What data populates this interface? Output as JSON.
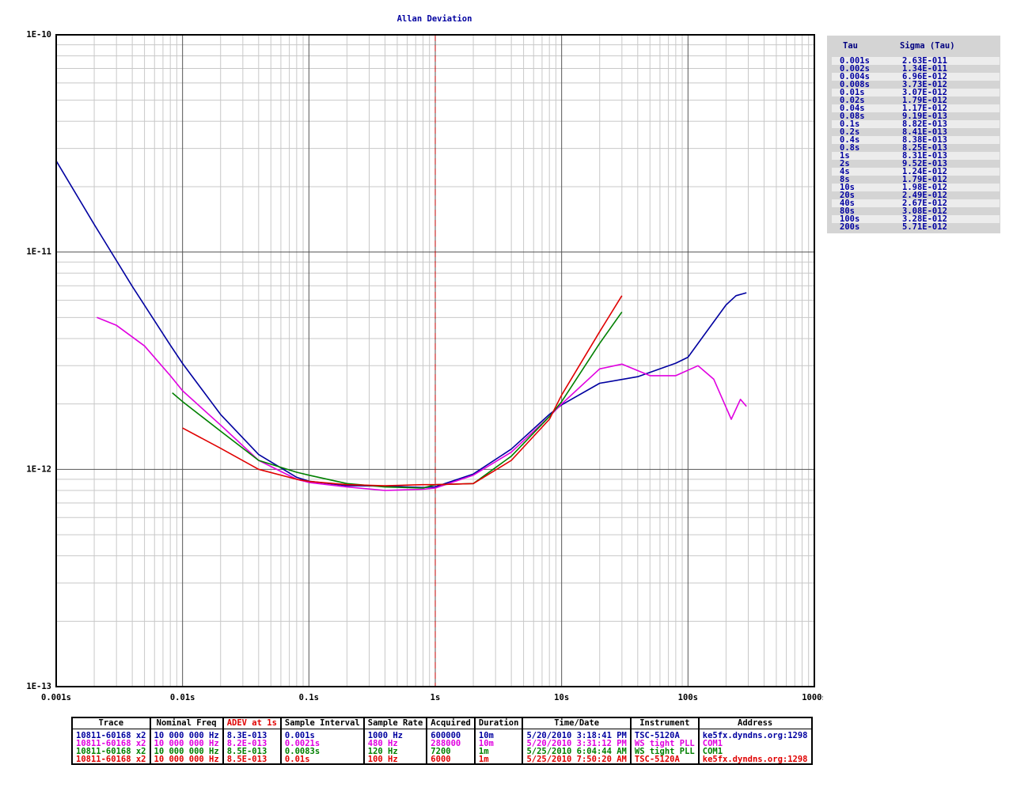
{
  "chart_data": {
    "type": "line",
    "title": "Allan Deviation",
    "x_scale": "log",
    "y_scale": "log",
    "xlim": [
      0.001,
      1000
    ],
    "ylim": [
      1e-13,
      1e-10
    ],
    "x_ticks": [
      {
        "v": 0.001,
        "label": "0.001s"
      },
      {
        "v": 0.01,
        "label": "0.01s"
      },
      {
        "v": 0.1,
        "label": "0.1s"
      },
      {
        "v": 1,
        "label": "1s"
      },
      {
        "v": 10,
        "label": "10s"
      },
      {
        "v": 100,
        "label": "100s"
      },
      {
        "v": 1000,
        "label": "1000s"
      }
    ],
    "y_ticks": [
      {
        "v": 1e-10,
        "label": "1E-10"
      },
      {
        "v": 1e-11,
        "label": "1E-11"
      },
      {
        "v": 1e-12,
        "label": "1E-12"
      },
      {
        "v": 1e-13,
        "label": "1E-13"
      }
    ],
    "grid": true,
    "marker_tau": 1,
    "series": [
      {
        "color": "#0000a0",
        "points": [
          [
            0.001,
            2.63e-11
          ],
          [
            0.002,
            1.34e-11
          ],
          [
            0.004,
            6.96e-12
          ],
          [
            0.008,
            3.73e-12
          ],
          [
            0.01,
            3.07e-12
          ],
          [
            0.02,
            1.79e-12
          ],
          [
            0.04,
            1.17e-12
          ],
          [
            0.08,
            9.19e-13
          ],
          [
            0.1,
            8.82e-13
          ],
          [
            0.2,
            8.41e-13
          ],
          [
            0.4,
            8.38e-13
          ],
          [
            0.8,
            8.25e-13
          ],
          [
            1,
            8.31e-13
          ],
          [
            2,
            9.52e-13
          ],
          [
            4,
            1.24e-12
          ],
          [
            8,
            1.79e-12
          ],
          [
            10,
            1.98e-12
          ],
          [
            20,
            2.49e-12
          ],
          [
            40,
            2.67e-12
          ],
          [
            80,
            3.08e-12
          ],
          [
            100,
            3.28e-12
          ],
          [
            200,
            5.71e-12
          ],
          [
            240,
            6.3e-12
          ],
          [
            290,
            6.5e-12
          ]
        ]
      },
      {
        "color": "#e000e0",
        "points": [
          [
            0.0021,
            5e-12
          ],
          [
            0.003,
            4.6e-12
          ],
          [
            0.005,
            3.7e-12
          ],
          [
            0.008,
            2.7e-12
          ],
          [
            0.01,
            2.3e-12
          ],
          [
            0.02,
            1.6e-12
          ],
          [
            0.04,
            1.1e-12
          ],
          [
            0.08,
            9e-13
          ],
          [
            0.1,
            8.7e-13
          ],
          [
            0.2,
            8.3e-13
          ],
          [
            0.4,
            8e-13
          ],
          [
            0.8,
            8.1e-13
          ],
          [
            1,
            8.2e-13
          ],
          [
            2,
            9.4e-13
          ],
          [
            4,
            1.2e-12
          ],
          [
            8,
            1.75e-12
          ],
          [
            10,
            2e-12
          ],
          [
            20,
            2.9e-12
          ],
          [
            30,
            3.05e-12
          ],
          [
            50,
            2.7e-12
          ],
          [
            80,
            2.7e-12
          ],
          [
            120,
            3e-12
          ],
          [
            160,
            2.6e-12
          ],
          [
            220,
            1.7e-12
          ],
          [
            260,
            2.1e-12
          ],
          [
            290,
            1.95e-12
          ]
        ]
      },
      {
        "color": "#008000",
        "points": [
          [
            0.0083,
            2.25e-12
          ],
          [
            0.01,
            2.05e-12
          ],
          [
            0.02,
            1.5e-12
          ],
          [
            0.04,
            1.1e-12
          ],
          [
            0.08,
            9.7e-13
          ],
          [
            0.1,
            9.4e-13
          ],
          [
            0.2,
            8.6e-13
          ],
          [
            0.4,
            8.3e-13
          ],
          [
            0.8,
            8.2e-13
          ],
          [
            1,
            8.5e-13
          ],
          [
            2,
            8.6e-13
          ],
          [
            4,
            1.15e-12
          ],
          [
            8,
            1.75e-12
          ],
          [
            10,
            2.05e-12
          ],
          [
            20,
            3.8e-12
          ],
          [
            30,
            5.3e-12
          ]
        ]
      },
      {
        "color": "#e00000",
        "points": [
          [
            0.01,
            1.55e-12
          ],
          [
            0.02,
            1.25e-12
          ],
          [
            0.04,
            1e-12
          ],
          [
            0.08,
            9e-13
          ],
          [
            0.1,
            8.8e-13
          ],
          [
            0.2,
            8.5e-13
          ],
          [
            0.4,
            8.4e-13
          ],
          [
            0.8,
            8.5e-13
          ],
          [
            1,
            8.5e-13
          ],
          [
            2,
            8.6e-13
          ],
          [
            4,
            1.1e-12
          ],
          [
            8,
            1.7e-12
          ],
          [
            10,
            2.2e-12
          ],
          [
            20,
            4.3e-12
          ],
          [
            30,
            6.3e-12
          ]
        ]
      }
    ]
  },
  "tau_table": {
    "tau_header": "Tau",
    "sigma_header": "Sigma (Tau)",
    "rows": [
      {
        "tau": "0.001s",
        "sigma": "2.63E-011"
      },
      {
        "tau": "0.002s",
        "sigma": "1.34E-011"
      },
      {
        "tau": "0.004s",
        "sigma": "6.96E-012"
      },
      {
        "tau": "0.008s",
        "sigma": "3.73E-012"
      },
      {
        "tau": "0.01s",
        "sigma": "3.07E-012"
      },
      {
        "tau": "0.02s",
        "sigma": "1.79E-012"
      },
      {
        "tau": "0.04s",
        "sigma": "1.17E-012"
      },
      {
        "tau": "0.08s",
        "sigma": "9.19E-013"
      },
      {
        "tau": "0.1s",
        "sigma": "8.82E-013"
      },
      {
        "tau": "0.2s",
        "sigma": "8.41E-013"
      },
      {
        "tau": "0.4s",
        "sigma": "8.38E-013"
      },
      {
        "tau": "0.8s",
        "sigma": "8.25E-013"
      },
      {
        "tau": "1s",
        "sigma": "8.31E-013"
      },
      {
        "tau": "2s",
        "sigma": "9.52E-013"
      },
      {
        "tau": "4s",
        "sigma": "1.24E-012"
      },
      {
        "tau": "8s",
        "sigma": "1.79E-012"
      },
      {
        "tau": "10s",
        "sigma": "1.98E-012"
      },
      {
        "tau": "20s",
        "sigma": "2.49E-012"
      },
      {
        "tau": "40s",
        "sigma": "2.67E-012"
      },
      {
        "tau": "80s",
        "sigma": "3.08E-012"
      },
      {
        "tau": "100s",
        "sigma": "3.28E-012"
      },
      {
        "tau": "200s",
        "sigma": "5.71E-012"
      }
    ]
  },
  "trace_table": {
    "headers": [
      "Trace",
      "Nominal Freq",
      "ADEV at 1s",
      "Sample Interval",
      "Sample Rate",
      "Acquired",
      "Duration",
      "Time/Date",
      "Instrument",
      "Address"
    ],
    "rows": [
      {
        "color": "#0000a0",
        "cells": [
          "10811-60168 x2",
          "10 000 000 Hz",
          "8.3E-013",
          "0.001s",
          "1000 Hz",
          "600000",
          "10m",
          "5/20/2010 3:18:41 PM",
          "TSC-5120A",
          "ke5fx.dyndns.org:1298"
        ]
      },
      {
        "color": "#e000e0",
        "cells": [
          "10811-60168 x2",
          "10 000 000 Hz",
          "8.2E-013",
          "0.0021s",
          "480 Hz",
          "288000",
          "10m",
          "5/20/2010 3:31:12 PM",
          "WS tight PLL",
          "COM1"
        ]
      },
      {
        "color": "#008000",
        "cells": [
          "10811-60168 x2",
          "10 000 000 Hz",
          "8.5E-013",
          "0.0083s",
          "120 Hz",
          "7200",
          "1m",
          "5/25/2010 6:04:44 AM",
          "WS tight PLL",
          "COM1"
        ]
      },
      {
        "color": "#e00000",
        "cells": [
          "10811-60168 x2",
          "10 000 000 Hz",
          "8.5E-013",
          "0.01s",
          "100 Hz",
          "6000",
          "1m",
          "5/25/2010 7:50:20 AM",
          "TSC-5120A",
          "ke5fx.dyndns.org:1298"
        ]
      }
    ]
  }
}
